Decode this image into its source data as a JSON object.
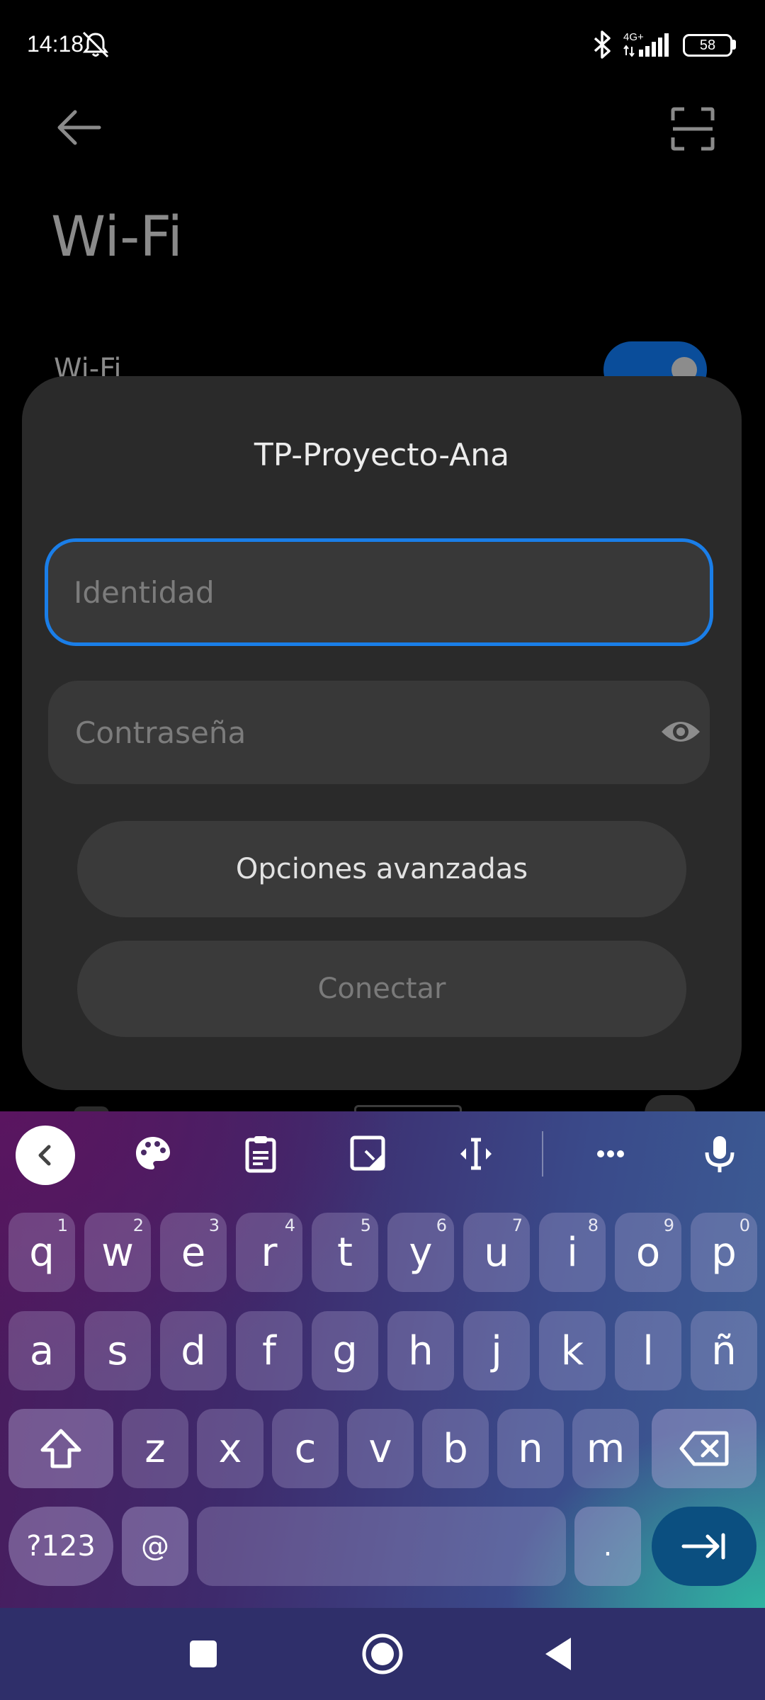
{
  "status_bar": {
    "time": "14:18",
    "network": "4G+",
    "battery": "58",
    "icons": [
      "bell-off-icon",
      "bluetooth-icon",
      "signal-icon",
      "battery-icon"
    ]
  },
  "app": {
    "title": "Wi-Fi",
    "wifi_label": "Wi-Fi",
    "wifi_enabled": true,
    "icons": [
      "back-arrow-icon",
      "qr-scan-icon"
    ]
  },
  "dialog": {
    "title": "TP-Proyecto-Ana",
    "identity_placeholder": "Identidad",
    "identity_value": "",
    "password_placeholder": "Contraseña",
    "password_value": "",
    "advanced_button": "Opciones avanzadas",
    "connect_button": "Conectar",
    "accent_color": "#1a7ee8"
  },
  "keyboard": {
    "toolbar": [
      "back-chevron-icon",
      "palette-icon",
      "clipboard-icon",
      "one-handed-icon",
      "text-cursor-icon",
      "more-icon",
      "microphone-icon"
    ],
    "row1": [
      {
        "key": "q",
        "hint": "1"
      },
      {
        "key": "w",
        "hint": "2"
      },
      {
        "key": "e",
        "hint": "3"
      },
      {
        "key": "r",
        "hint": "4"
      },
      {
        "key": "t",
        "hint": "5"
      },
      {
        "key": "y",
        "hint": "6"
      },
      {
        "key": "u",
        "hint": "7"
      },
      {
        "key": "i",
        "hint": "8"
      },
      {
        "key": "o",
        "hint": "9"
      },
      {
        "key": "p",
        "hint": "0"
      }
    ],
    "row2": [
      "a",
      "s",
      "d",
      "f",
      "g",
      "h",
      "j",
      "k",
      "l",
      "ñ"
    ],
    "row3": [
      "z",
      "x",
      "c",
      "v",
      "b",
      "n",
      "m"
    ],
    "symbols_key": "?123",
    "at_key": "@",
    "period_key": ".",
    "enter_color": "#0b4f80"
  },
  "nav_bar": {
    "icons": [
      "recents-icon",
      "home-icon",
      "back-icon"
    ]
  }
}
